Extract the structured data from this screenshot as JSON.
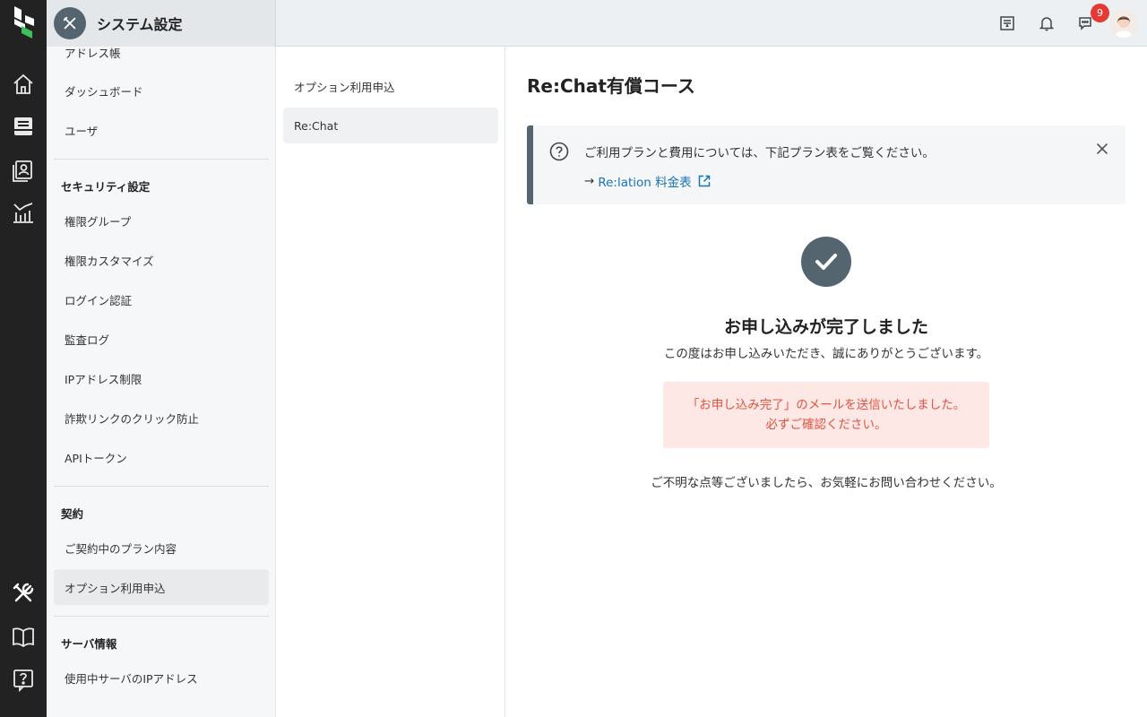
{
  "header": {
    "title": "システム設定",
    "notification_count": "9"
  },
  "sidebar": {
    "items_top": [
      {
        "label": "アドレス帳"
      },
      {
        "label": "ダッシュボード"
      },
      {
        "label": "ユーザ"
      }
    ],
    "security": {
      "heading": "セキュリティ設定",
      "items": [
        {
          "label": "権限グループ"
        },
        {
          "label": "権限カスタマイズ"
        },
        {
          "label": "ログイン認証"
        },
        {
          "label": "監査ログ"
        },
        {
          "label": "IPアドレス制限"
        },
        {
          "label": "詐欺リンクのクリック防止"
        },
        {
          "label": "APIトークン"
        }
      ]
    },
    "contract": {
      "heading": "契約",
      "items": [
        {
          "label": "ご契約中のプラン内容"
        },
        {
          "label": "オプション利用申込"
        }
      ]
    },
    "server": {
      "heading": "サーバ情報",
      "items": [
        {
          "label": "使用中サーバのIPアドレス"
        }
      ]
    }
  },
  "subnav": {
    "items": [
      {
        "label": "オプション利用申込"
      },
      {
        "label": "Re:Chat"
      }
    ]
  },
  "main": {
    "title": "Re:Chat有償コース",
    "info": {
      "text": "ご利用プランと費用については、下記プラン表をご覧ください。",
      "arrow": "→",
      "link_label": "Re:lation 料金表"
    },
    "done_title": "お申し込みが完了しました",
    "done_sub": "この度はお申し込みいただき、誠にありがとうございます。",
    "mail_notice_line1": "「お申し込み完了」のメールを送信いたしました。",
    "mail_notice_line2": "必ずご確認ください。",
    "inquiry": "ご不明な点等ございましたら、お気軽にお問い合わせください。"
  },
  "icons": {
    "rail": [
      "home-icon",
      "inbox-icon",
      "address-book-icon",
      "analytics-icon",
      "tools-icon",
      "manual-book-icon",
      "help-icon"
    ],
    "header": [
      "contract-icon",
      "bell-icon",
      "chat-icon"
    ]
  },
  "colors": {
    "rail_bg": "#222222",
    "accent_slate": "#55656f",
    "link": "#1a73b5",
    "notice_bg": "#fde8e6",
    "notice_text": "#e0533f",
    "badge": "#e53935"
  }
}
